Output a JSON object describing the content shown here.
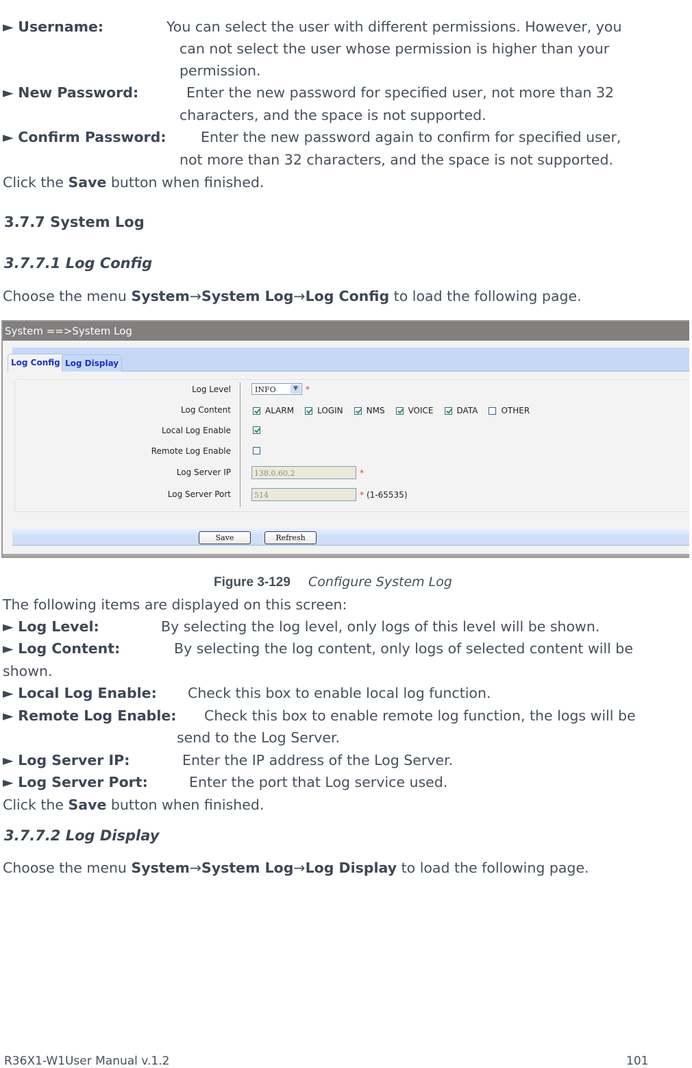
{
  "intro_items": [
    {
      "label": "Username:",
      "lines": [
        "You can select the user with different permissions. However, you",
        "can not select the user whose permission is higher than your",
        "permission."
      ]
    },
    {
      "label": "New Password:",
      "lines": [
        "Enter the new password for specified user, not more than 32",
        "characters, and the space is not supported."
      ]
    },
    {
      "label": "Confirm Password:",
      "lines": [
        "Enter the new password again to confirm for specified user,",
        "not more than 32 characters, and the space is not supported."
      ]
    }
  ],
  "click_save_1": {
    "pre": "Click the ",
    "bold": "Save",
    "post": " button when finished."
  },
  "section": {
    "title": "3.7.7 System Log"
  },
  "subsection1": {
    "title": "3.7.7.1  Log Config",
    "menu_pre": "Choose the menu ",
    "menu_path": [
      "System",
      "System Log",
      "Log Config"
    ],
    "menu_post": " to load the following page."
  },
  "figure": {
    "breadcrumb": "System ==>System Log",
    "tabs": [
      {
        "label": "Log Config",
        "active": true
      },
      {
        "label": "Log Display",
        "active": false
      }
    ],
    "fields": {
      "log_level": {
        "label": "Log Level",
        "value": "INFO",
        "required": "*"
      },
      "log_content": {
        "label": "Log Content",
        "options": [
          {
            "label": "ALARM",
            "checked": true
          },
          {
            "label": "LOGIN",
            "checked": true
          },
          {
            "label": "NMS",
            "checked": true
          },
          {
            "label": "VOICE",
            "checked": true
          },
          {
            "label": "DATA",
            "checked": true
          },
          {
            "label": "OTHER",
            "checked": false
          }
        ]
      },
      "local_log_enable": {
        "label": "Local Log Enable",
        "checked": true
      },
      "remote_log_enable": {
        "label": "Remote Log Enable",
        "checked": false
      },
      "log_server_ip": {
        "label": "Log Server IP",
        "value": "138.0.60.2",
        "required": "*"
      },
      "log_server_port": {
        "label": "Log Server Port",
        "value": "514",
        "required": "*",
        "hint": "(1-65535)"
      }
    },
    "buttons": {
      "save": "Save",
      "refresh": "Refresh"
    },
    "caption_number": "Figure 3-129",
    "caption_title": "Configure System Log"
  },
  "items_intro": "The following items are displayed on this screen:",
  "items": [
    {
      "label": "Log Level:",
      "lines": [
        "By selecting the log level, only logs of this level will be shown."
      ]
    },
    {
      "label": "Log Content:",
      "lines": [
        "By selecting the log content, only logs of selected content will be",
        "shown."
      ]
    },
    {
      "label": "Local Log Enable:",
      "lines": [
        "Check this box to enable local log function."
      ]
    },
    {
      "label": "Remote Log Enable:",
      "lines": [
        "Check this box to enable remote log function, the logs will be",
        "send to the Log Server."
      ]
    },
    {
      "label": "Log Server IP:",
      "lines": [
        "Enter the IP address of the Log Server."
      ]
    },
    {
      "label": "Log Server Port:",
      "lines": [
        "Enter the port that Log service used."
      ]
    }
  ],
  "click_save_2": {
    "pre": "Click the ",
    "bold": "Save",
    "post": " button when finished."
  },
  "subsection2": {
    "title": "3.7.7.2  Log Display",
    "menu_pre": "Choose the menu ",
    "menu_path": [
      "System",
      "System Log",
      "Log Display"
    ],
    "menu_post": " to load the following page."
  },
  "footer": {
    "manual": "R36X1-W1User Manual v.1.2",
    "page": "101"
  },
  "arrow_glyph": "►",
  "path_separator": "→"
}
